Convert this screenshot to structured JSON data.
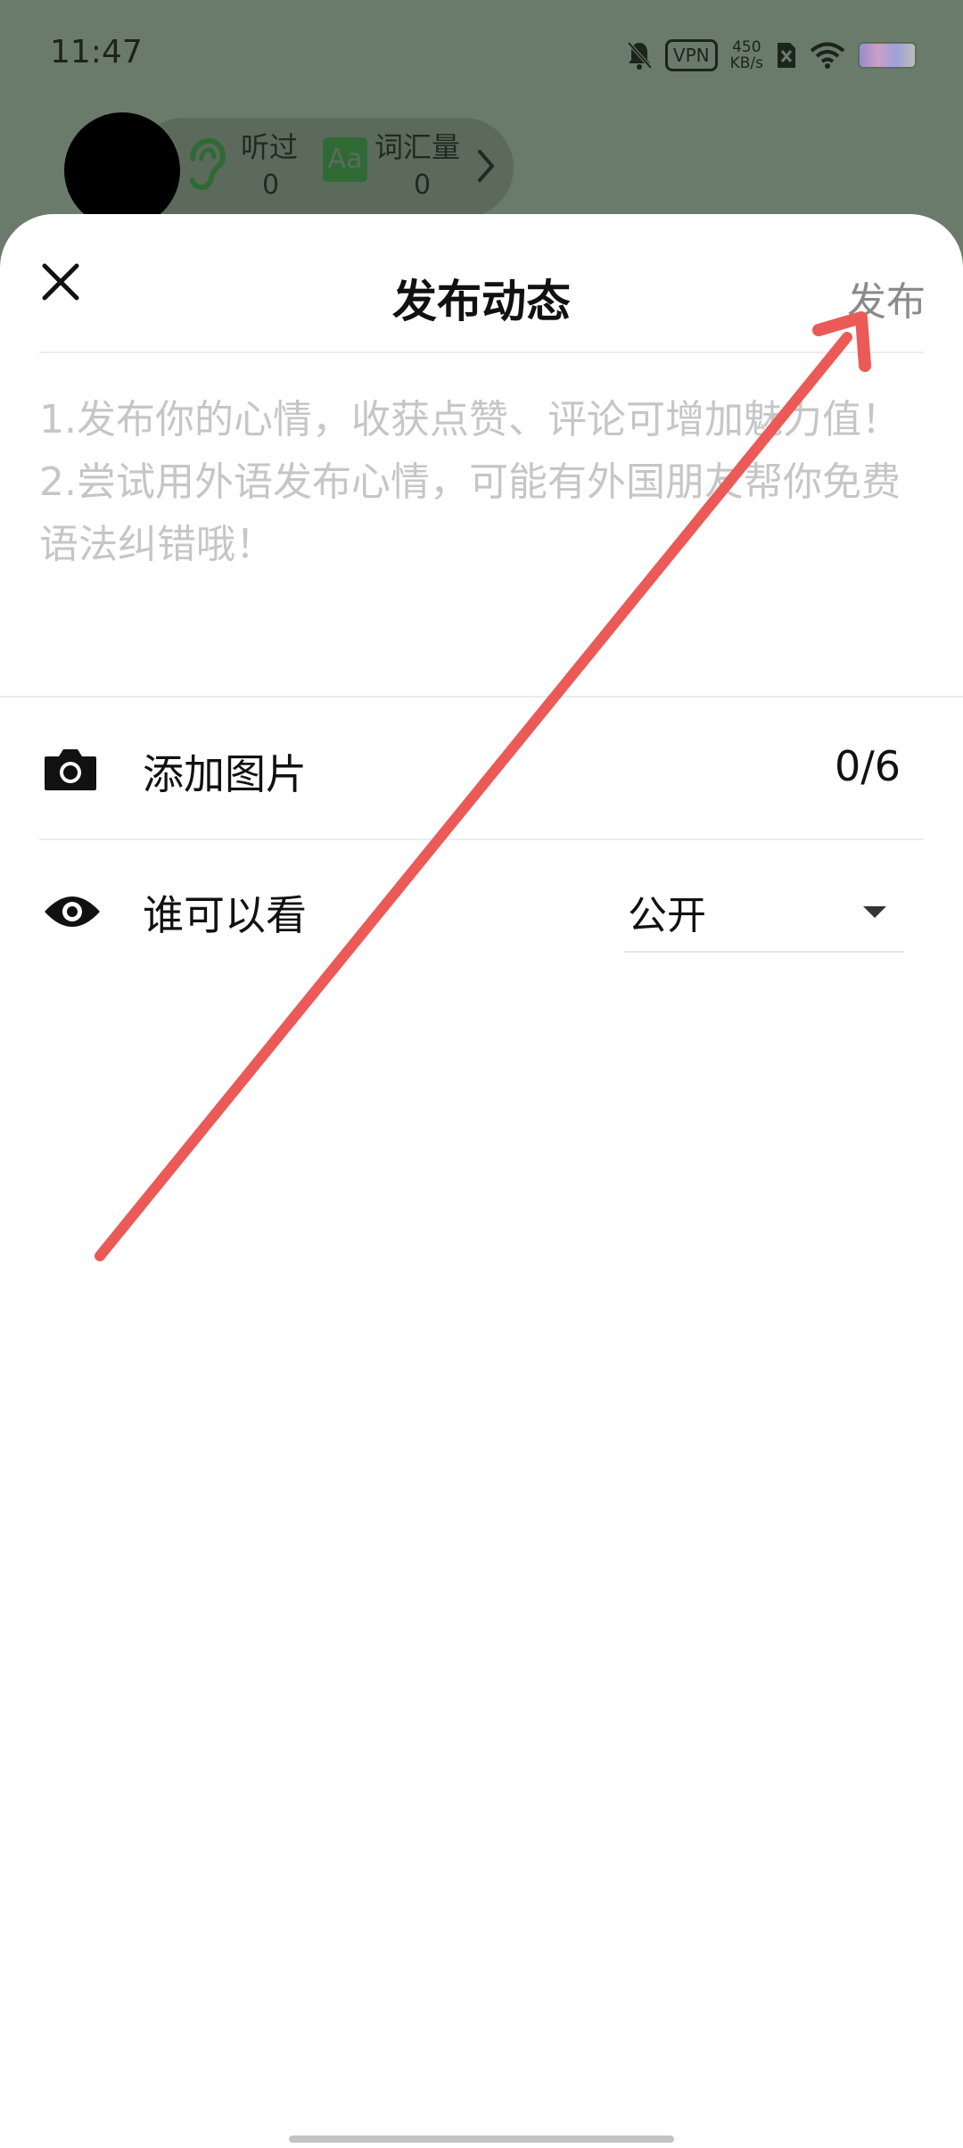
{
  "status_bar": {
    "time": "11:47",
    "vpn_label": "VPN",
    "speed_value": "450",
    "speed_unit": "KB/s",
    "icons": [
      "bell-off-icon",
      "vpn-icon",
      "sim-off-icon",
      "wifi-icon",
      "battery-icon"
    ]
  },
  "background_profile": {
    "stats": [
      {
        "label": "听过",
        "value": "0",
        "icon": "ear-icon"
      },
      {
        "label": "词汇量",
        "value": "0",
        "icon": "vocabulary-icon"
      }
    ],
    "vocab_icon_text": "Aa"
  },
  "sheet": {
    "title": "发布动态",
    "close_icon": "close-icon",
    "publish_label": "发布",
    "content_placeholder": "1.发布你的心情，收获点赞、评论可增加魅力值！\n2.尝试用外语发布心情，可能有外国朋友帮你免费语法纠错哦！",
    "add_image": {
      "icon": "camera-icon",
      "label": "添加图片",
      "count": "0/6"
    },
    "visibility": {
      "icon": "eye-icon",
      "label": "谁可以看",
      "value": "公开",
      "caret_icon": "caret-down-icon"
    }
  },
  "colors": {
    "annotation_arrow": "#eb5a57",
    "publish_text": "#8a8a8a",
    "placeholder_text": "#c6c6c6",
    "overlay": "#6b7b6b"
  }
}
